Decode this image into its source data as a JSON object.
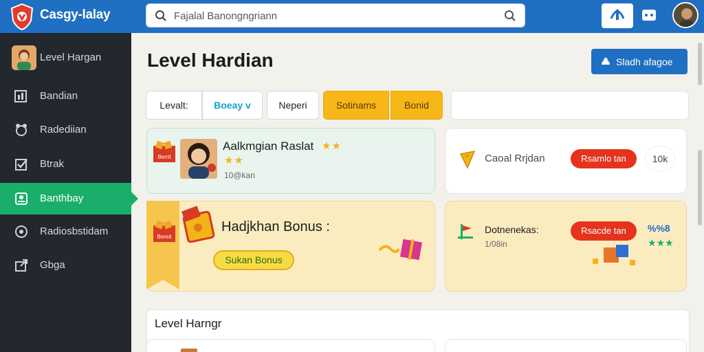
{
  "app": {
    "brand": "Casgy-lalay",
    "search_placeholder": "Fajalal Banongngriann",
    "icons": [
      "shield-logo-icon",
      "search-icon",
      "share-icon",
      "chat-icon",
      "user-avatar"
    ],
    "colors": {
      "topbar": "#1f6fc2",
      "sidebar": "#23272e",
      "active": "#1aae6b",
      "accent_yellow": "#f7b718",
      "red": "#e5331e"
    }
  },
  "sidebar": {
    "items": [
      {
        "label": "Level Hargan",
        "icon": "avatar"
      },
      {
        "label": "Bandian",
        "icon": "chart-icon"
      },
      {
        "label": "Radediian",
        "icon": "gift-icon"
      },
      {
        "label": "Btrak",
        "icon": "checkbox-icon"
      },
      {
        "label": "Banthbay",
        "icon": "user-card-icon",
        "active": true
      },
      {
        "label": "Radiosbstidam",
        "icon": "target-icon"
      },
      {
        "label": "Gbga",
        "icon": "export-icon"
      }
    ]
  },
  "main": {
    "title": "Level Hardian",
    "action_label": "Sladh afagoe",
    "tabs": [
      {
        "label": "Levalt:"
      },
      {
        "label": "Boeay v"
      },
      {
        "label": "Neperi"
      },
      {
        "label": "Sotinams"
      },
      {
        "label": "Bonid"
      }
    ]
  },
  "cards": {
    "daily": {
      "badge": "Berrit",
      "title": "Aalkmgian Raslat",
      "stars_top": "★★",
      "stars_bottom": "★★",
      "sub": "10@kan"
    },
    "casual": {
      "label": "Caoal Rrjdan",
      "pill": "Rsamlo tan",
      "count": "10k"
    },
    "bonus": {
      "badge": "Bereit",
      "title": "Hadjkhan Bonus :",
      "button": "Sukan Bonus"
    },
    "bonus_side": {
      "title": "Dotnenekas:",
      "sub": "1/08in",
      "pill": "Rsacde tan",
      "score": "%%8",
      "stars": "★★★"
    }
  },
  "section": {
    "title": "Level Harngr"
  }
}
